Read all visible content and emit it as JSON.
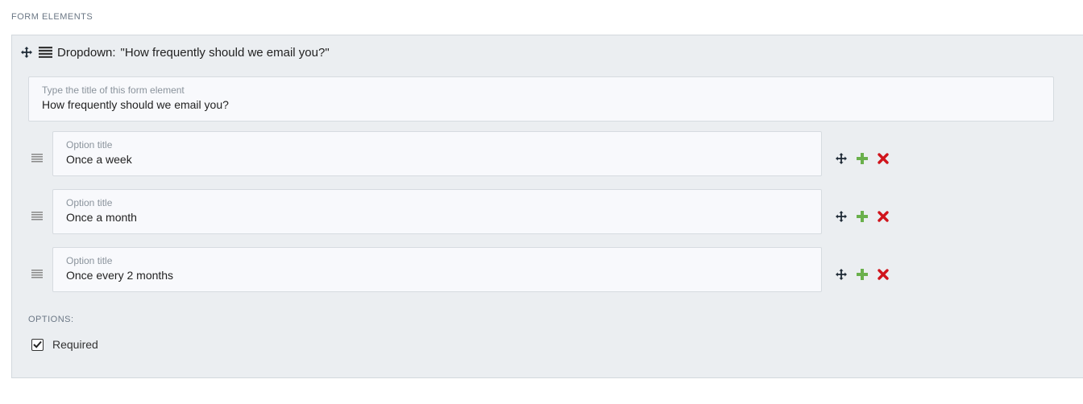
{
  "section": {
    "heading": "FORM ELEMENTS"
  },
  "element": {
    "type_label": "Dropdown:",
    "title_quoted": "\"How frequently should we email you?\"",
    "title_field": {
      "label": "Type the title of this form element",
      "value": "How frequently should we email you?"
    },
    "options": [
      {
        "label": "Option title",
        "value": "Once a week"
      },
      {
        "label": "Option title",
        "value": "Once a month"
      },
      {
        "label": "Option title",
        "value": "Once every 2 months"
      }
    ],
    "options_heading": "OPTIONS:",
    "required": {
      "label": "Required",
      "checked": true
    }
  },
  "icons": {
    "move": "move-icon",
    "list": "list-icon",
    "drag_handle": "drag-handle-icon",
    "add": "plus-icon",
    "remove": "close-icon",
    "check": "checkmark-icon"
  },
  "colors": {
    "panel_bg": "#ebeef1",
    "add": "#6ab04c",
    "remove": "#d0141c"
  }
}
